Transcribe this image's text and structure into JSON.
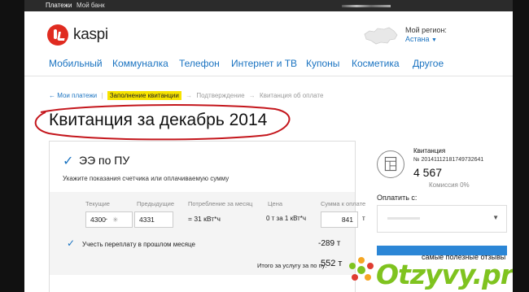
{
  "topbar": {
    "items": [
      "Платежи",
      "Мой банк"
    ]
  },
  "header": {
    "logo_text": "kaspi",
    "region_label": "Мой регион:",
    "region_value": "Астана"
  },
  "nav": {
    "items": [
      "Мобильный",
      "Коммуналка",
      "Телефон",
      "Интернет и ТВ",
      "Купоны",
      "Косметика",
      "Другое"
    ]
  },
  "breadcrumb": {
    "back": "← Мои платежи",
    "steps": [
      "Заполнение квитанции",
      "Подтверждение",
      "Квитанция об оплате"
    ]
  },
  "page_title": "Квитанция за декабрь 2014",
  "service": {
    "name": "ЭЭ по ПУ",
    "subtitle": "Укажите показания счетчика или оплачиваемую сумму",
    "columns": [
      "Текущие",
      "Предыдущие",
      "Потребление за месяц",
      "Цена",
      "Сумма к оплате"
    ],
    "current": "4300",
    "previous": "4331",
    "consumption": "= 31 кВт*ч",
    "price": "0  т за 1 кВт*ч",
    "amount": "841",
    "currency": "т",
    "overpay_label": "Учесть переплату в прошлом месяце",
    "overpay_value": "-289 т",
    "total_label": "Итого за услугу за по пу:",
    "total_value": "552 т"
  },
  "receipt": {
    "title": "Квитанция",
    "number": "№ 20141112181749732641",
    "amount": "4 567",
    "fee": "Комиссия 0%"
  },
  "payment": {
    "label": "Оплатить с:"
  },
  "watermark": {
    "tagline": "самые полезные отзывы",
    "brand": "Otzyvy.pro"
  },
  "colors": {
    "accent": "#1a73c1",
    "logo_red": "#e02b20",
    "highlight": "#f7e300",
    "brand_green": "#7fc31f",
    "annotation_red": "#c4161c"
  }
}
